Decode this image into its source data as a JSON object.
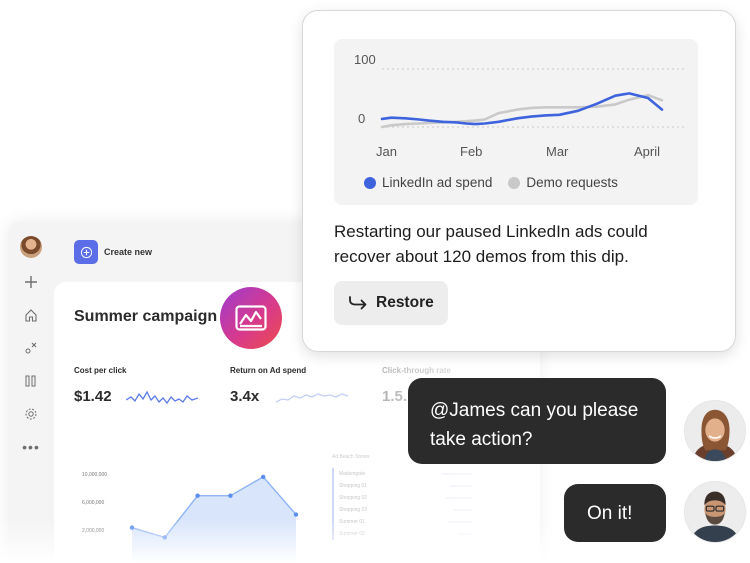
{
  "app": {
    "create_label": "Create new",
    "campaign_title": "Summer campaign",
    "metrics": [
      {
        "label": "Cost per click",
        "value": "$1.42"
      },
      {
        "label": "Return on Ad spend",
        "value": "3.4x"
      },
      {
        "label": "Click-through rate",
        "value": "1.5..."
      }
    ],
    "area_chart": {
      "y_ticks": [
        "10,000,000",
        "6,000,000",
        "2,000,000"
      ],
      "values": [
        4.2,
        3.0,
        8.1,
        8.1,
        10.4,
        5.8
      ]
    },
    "side_list": {
      "header": "Ad Beach Stores",
      "rows": [
        "Maidengate",
        "Shopping 01",
        "Shopping 02",
        "Shopping 03",
        "Summer 01",
        "Summer 02"
      ]
    }
  },
  "card": {
    "chart": {
      "y_ticks": [
        "100",
        "0"
      ],
      "x_ticks": [
        "Jan",
        "Feb",
        "Mar",
        "April"
      ],
      "legend": [
        "LinkedIn ad spend",
        "Demo requests"
      ]
    },
    "message": "Restarting our paused LinkedIn ads could recover about 120 demos from this dip.",
    "restore_label": "Restore"
  },
  "chart_data": {
    "type": "line",
    "x": [
      "Jan",
      "Feb",
      "Mar",
      "April"
    ],
    "ylim": [
      0,
      100
    ],
    "series": [
      {
        "name": "LinkedIn ad spend",
        "color": "#3e63dd",
        "x_pos": [
          0,
          0.1,
          0.25,
          0.4,
          0.5,
          0.65,
          0.8,
          0.9,
          1.0,
          1.1,
          1.25,
          1.45,
          1.6,
          1.75,
          1.9,
          2.1,
          2.3,
          2.5,
          2.65,
          2.85,
          3.0
        ],
        "values": [
          14,
          16,
          15,
          13,
          11,
          9,
          8,
          6,
          5,
          6,
          9,
          15,
          18,
          20,
          21,
          28,
          40,
          54,
          58,
          50,
          30
        ]
      },
      {
        "name": "Demo requests",
        "color": "#c9c9c9",
        "x_pos": [
          0,
          0.1,
          0.25,
          0.4,
          0.5,
          0.65,
          0.8,
          0.9,
          1.0,
          1.1,
          1.25,
          1.45,
          1.6,
          1.75,
          1.9,
          2.1,
          2.3,
          2.5,
          2.65,
          2.85,
          3.0
        ],
        "values": [
          0,
          3,
          5,
          6,
          7,
          8,
          9,
          10,
          11,
          13,
          24,
          30,
          33,
          34,
          34,
          34,
          35,
          39,
          47,
          55,
          46
        ]
      }
    ]
  },
  "chat": {
    "message1": "@James can you please take action?",
    "message2": "On it!"
  },
  "colors": {
    "accent": "#5b6ee8",
    "linkedin_line": "#3e63dd",
    "demo_line": "#c9c9c9",
    "bubble_bg": "#2b2b2b"
  },
  "icons": [
    "avatar",
    "plus-icon",
    "home-icon",
    "shapes-icon",
    "library-icon",
    "gear-icon",
    "more-icon",
    "create-icon",
    "chart-badge-icon",
    "restore-arrow-icon"
  ]
}
